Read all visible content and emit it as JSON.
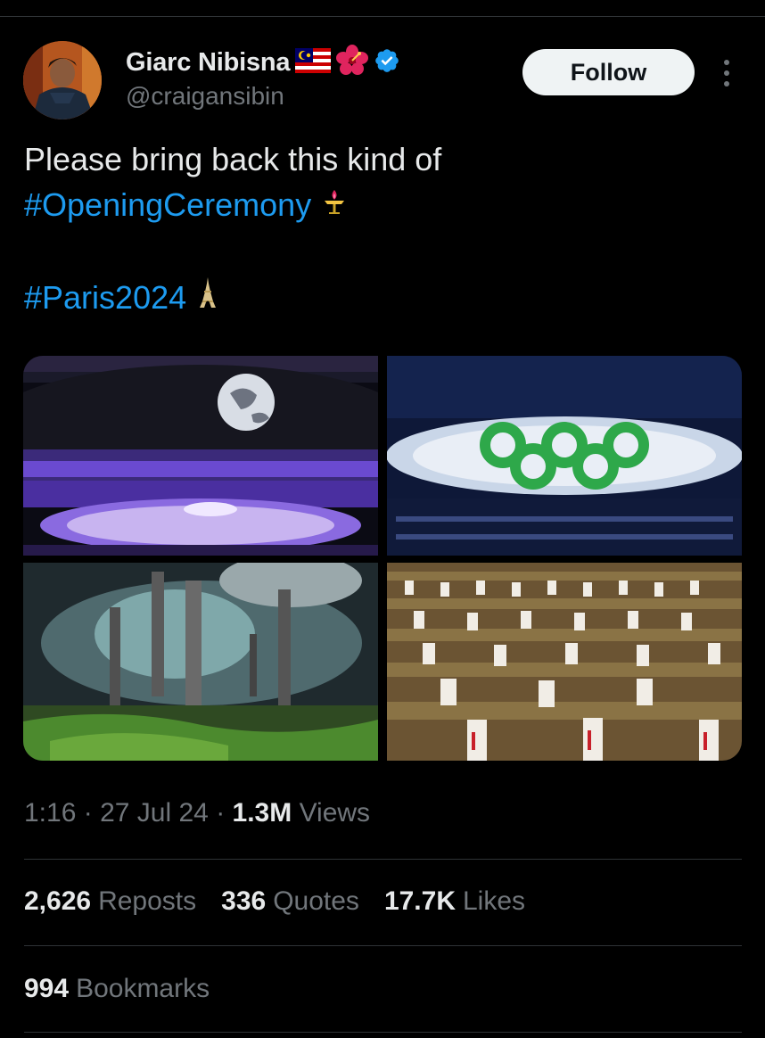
{
  "author": {
    "display_name": "Giarc Nibisna",
    "handle": "@craigansibin",
    "badges": [
      "malaysia-flag-icon",
      "hibiscus-icon",
      "verified-badge-icon"
    ],
    "verified_color": "#1d9bf0"
  },
  "actions": {
    "follow_label": "Follow",
    "more_icon": "more-options-icon"
  },
  "tweet": {
    "line1": "Please bring back this kind of",
    "hashtag1": "#OpeningCeremony",
    "hashtag1_icon": "olympic-torch-icon",
    "hashtag2": "#Paris2024",
    "hashtag2_icon": "eiffel-tower-icon"
  },
  "media": [
    {
      "icon": "stadium-globe-photo"
    },
    {
      "icon": "olympic-rings-photo"
    },
    {
      "icon": "smokestacks-photo"
    },
    {
      "icon": "drummers-photo"
    }
  ],
  "meta": {
    "time": "1:16",
    "separator": "·",
    "date": "27 Jul 24",
    "views_count": "1.3M",
    "views_label": "Views"
  },
  "stats": {
    "reposts_count": "2,626",
    "reposts_label": "Reposts",
    "quotes_count": "336",
    "quotes_label": "Quotes",
    "likes_count": "17.7K",
    "likes_label": "Likes",
    "bookmarks_count": "994",
    "bookmarks_label": "Bookmarks"
  },
  "colors": {
    "background": "#000000",
    "text_primary": "#e7e9ea",
    "text_secondary": "#71767b",
    "link": "#1d9bf0",
    "divider": "#2f3336"
  }
}
